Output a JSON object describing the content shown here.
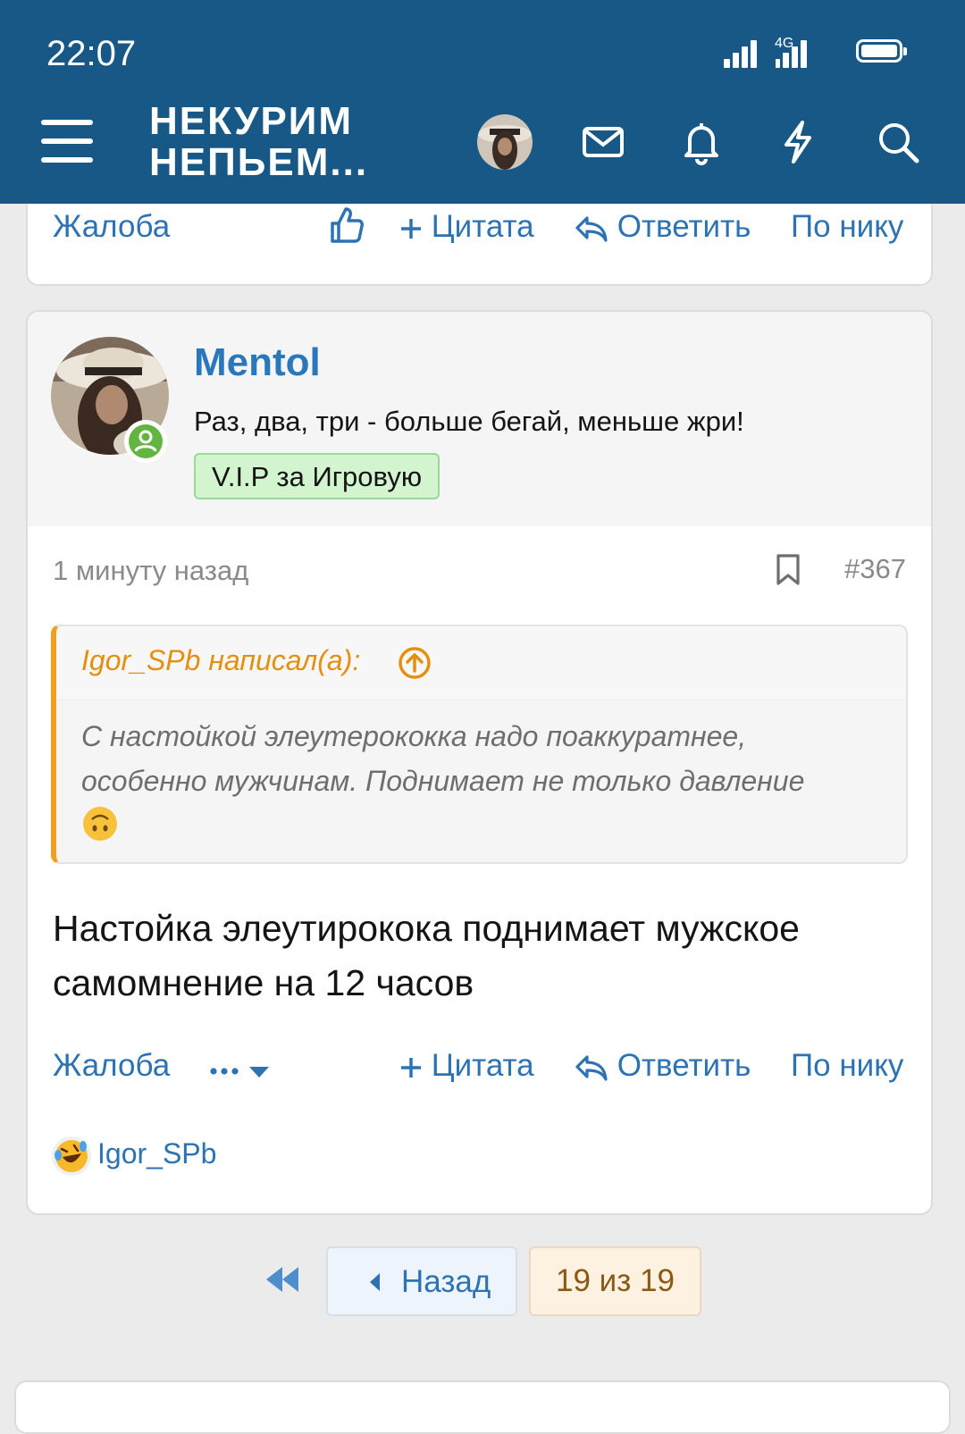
{
  "status_bar": {
    "time": "22:07",
    "network": "4G"
  },
  "header": {
    "logo_line1": "НЕКУРИМ",
    "logo_line2": "НЕПЬЕМ..."
  },
  "prev_post": {
    "actions": {
      "report": "Жалоба",
      "quote": "Цитата",
      "reply": "Ответить",
      "by_nick": "По нику"
    }
  },
  "post": {
    "author": "Mentol",
    "user_title": "Раз, два, три - больше бегай, меньше жри!",
    "badge": "V.I.P за Игровую",
    "date": "1 минуту назад",
    "number": "#367",
    "quote": {
      "author": "Igor_SPb написал(а):",
      "line1": "С настойкой элеутерококка надо поаккуратнее,",
      "line2": "особенно мужчинам. Поднимает не только давление"
    },
    "text_line1": "Настойка элеутирокока поднимает мужское",
    "text_line2": "самомнение на 12 часов",
    "actions": {
      "report": "Жалоба",
      "quote": "Цитата",
      "reply": "Ответить",
      "by_nick": "По нику"
    },
    "reaction_user": "Igor_SPb"
  },
  "pagination": {
    "back": "Назад",
    "current": "19 из 19"
  },
  "colors": {
    "header": "#185886",
    "link": "#2d73b4",
    "quote_accent": "#f0a01a"
  }
}
